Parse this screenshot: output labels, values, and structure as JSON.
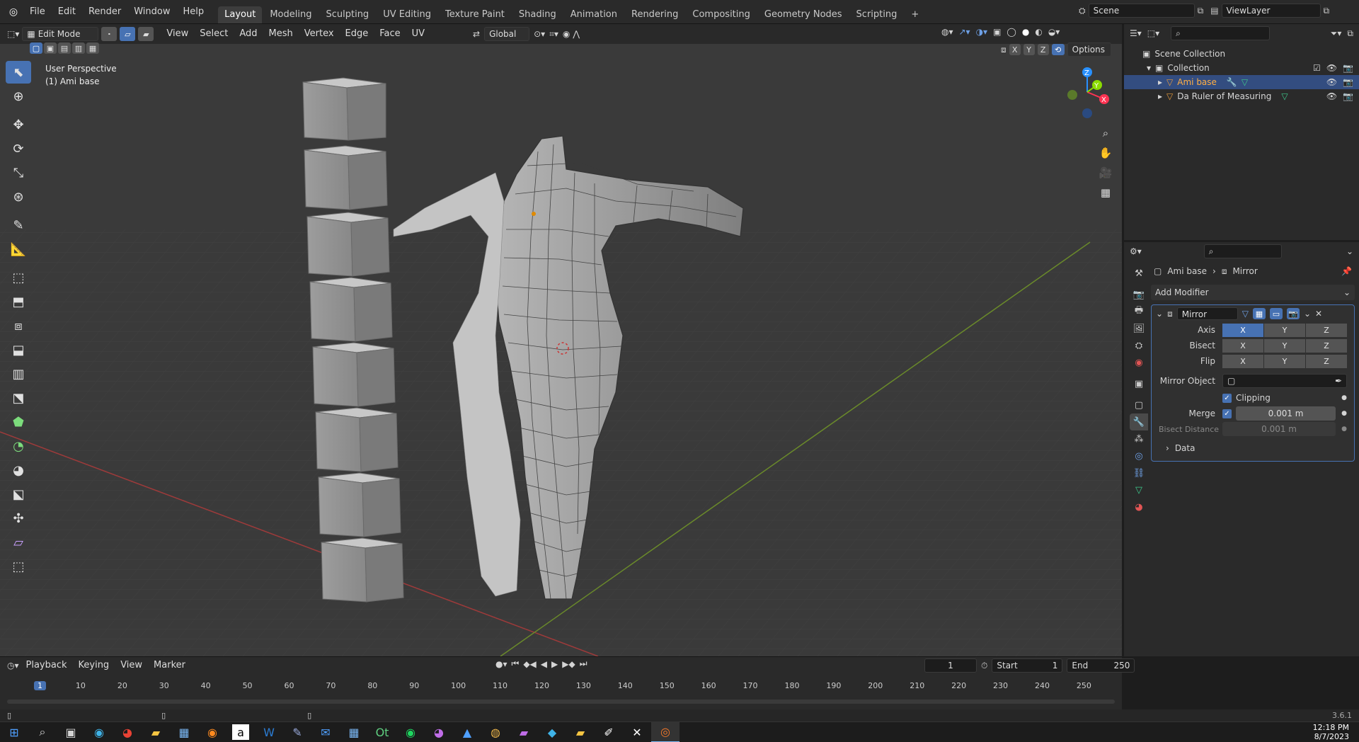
{
  "menu": {
    "items": [
      "File",
      "Edit",
      "Render",
      "Window",
      "Help"
    ]
  },
  "workspaces": {
    "tabs": [
      "Layout",
      "Modeling",
      "Sculpting",
      "UV Editing",
      "Texture Paint",
      "Shading",
      "Animation",
      "Rendering",
      "Compositing",
      "Geometry Nodes",
      "Scripting"
    ],
    "active": "Layout"
  },
  "scene": {
    "label": "Scene",
    "view_layer": "ViewLayer"
  },
  "viewport": {
    "mode": "Edit Mode",
    "menus": [
      "View",
      "Select",
      "Add",
      "Mesh",
      "Vertex",
      "Edge",
      "Face",
      "UV"
    ],
    "transform_orientation": "Global",
    "overlay_text": [
      "User Perspective",
      "(1) Ami base"
    ],
    "options_label": "Options",
    "axis_labels": [
      "X",
      "Y",
      "Z"
    ]
  },
  "outliner": {
    "root": "Scene Collection",
    "collection": "Collection",
    "items": [
      "Ami base",
      "Da Ruler of Measuring"
    ]
  },
  "properties": {
    "breadcrumb_object": "Ami base",
    "breadcrumb_modifier": "Mirror",
    "add_modifier": "Add Modifier",
    "modifier_name": "Mirror",
    "rows": {
      "axis": "Axis",
      "bisect": "Bisect",
      "flip": "Flip"
    },
    "xyz": [
      "X",
      "Y",
      "Z"
    ],
    "mirror_object_label": "Mirror Object",
    "clipping_label": "Clipping",
    "merge_label": "Merge",
    "merge_value": "0.001 m",
    "bisect_distance_label": "Bisect Distance",
    "bisect_distance_value": "0.001 m",
    "data_label": "Data"
  },
  "timeline": {
    "menus": [
      "Playback",
      "Keying",
      "View",
      "Marker"
    ],
    "current_frame": "1",
    "start_label": "Start",
    "start_value": "1",
    "end_label": "End",
    "end_value": "250",
    "ruler": [
      "1",
      "10",
      "20",
      "30",
      "40",
      "50",
      "60",
      "70",
      "80",
      "90",
      "100",
      "110",
      "120",
      "130",
      "140",
      "150",
      "160",
      "170",
      "180",
      "190",
      "200",
      "210",
      "220",
      "230",
      "240",
      "250"
    ]
  },
  "status": {
    "version": "3.6.1"
  },
  "taskbar": {
    "time": "12:18 PM",
    "date": "8/7/2023"
  },
  "colors": {
    "accent": "#4772b3",
    "selected_row": "#334d80",
    "x_axis": "#ff3352",
    "y_axis": "#8bdc00",
    "z_axis": "#2890ff"
  }
}
